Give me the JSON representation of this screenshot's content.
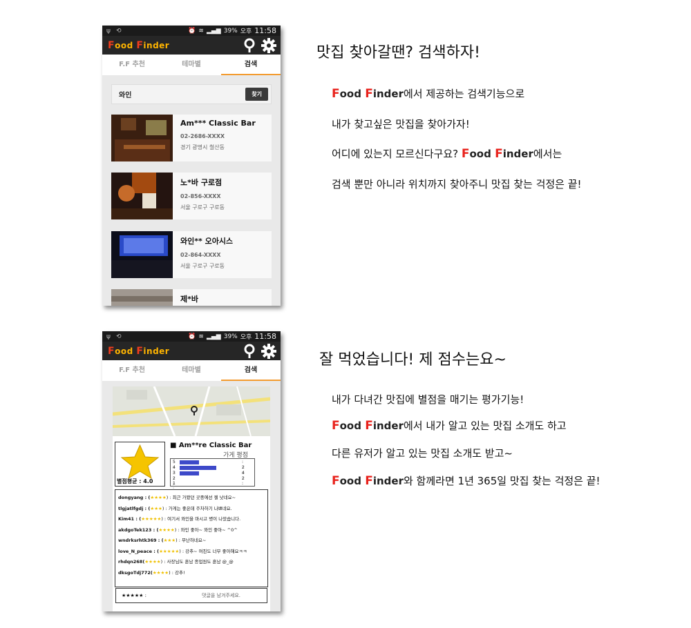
{
  "status_bar": {
    "battery": "39%",
    "time_prefix": "오후",
    "time": "11:58"
  },
  "app": {
    "logo_word1_cap": "F",
    "logo_word1_rest": "ood",
    "logo_word2_cap": "F",
    "logo_word2_rest": "inder"
  },
  "tabs": [
    {
      "label": "F.F 추천"
    },
    {
      "label": "테마별"
    },
    {
      "label": "검색",
      "active": true
    }
  ],
  "search": {
    "value": "와인",
    "button": "찾기"
  },
  "results": [
    {
      "name": "Am*** Classic Bar",
      "phone": "02-2686-XXXX",
      "address": "경기 광명시 철산동"
    },
    {
      "name": "노*바 구로점",
      "phone": "02-856-XXXX",
      "address": "서울 구로구 구로동"
    },
    {
      "name": "와인** 오아시스",
      "phone": "02-864-XXXX",
      "address": "서울 구로구 구로동"
    },
    {
      "name": "제*바",
      "phone": "",
      "address": ""
    }
  ],
  "section1": {
    "heading": "맛집 찾아갈땐? 검색하자!",
    "line1_suffix": "에서 제공하는 검색기능으로",
    "line2": "내가 찾고싶은 맛집을 찾아가자!",
    "line3_prefix": "어디에 있는지 모르신다구요? ",
    "line3_suffix": "에서는",
    "line4": "검색 뿐만 아니라 위치까지 찾아주니 맛집 찾는 걱정은 끝!"
  },
  "section2": {
    "heading": "잘 먹었습니다! 제 점수는요~",
    "line1": "내가 다녀간 맛집에 별점을 매기는 평가기능!",
    "line2_suffix": "에서 내가 알고 있는 맛집 소개도 하고",
    "line3": "다른 유저가 알고 있는 맛집 소개도 받고~",
    "line4_suffix": "와 함께라면 1년 365일 맛집 찾는 걱정은 끝!"
  },
  "store": {
    "title": "■ Am**re Classic Bar",
    "subtitle": "가게 평점",
    "average_label": "별점평균 : 4.0",
    "ratings": [
      {
        "label": "5 :",
        "fraction": 0.32,
        "count": ": 2"
      },
      {
        "label": "4 :",
        "fraction": 0.62,
        "count": ": 4"
      },
      {
        "label": "3 :",
        "fraction": 0.32,
        "count": ": 2"
      },
      {
        "label": "2 :",
        "fraction": 0,
        "count": ":"
      },
      {
        "label": "1 :",
        "fraction": 0,
        "count": ":"
      }
    ]
  },
  "reviews": [
    {
      "user": "dongyang : (",
      "stars": "★★★★",
      "text": ") : 최근 가봤던 곳중에선 젤 낫네요~"
    },
    {
      "user": "tlgjatlfgdj : (",
      "stars": "★★★",
      "text": ") : 가게는 좋은데 주차하기 나쁘네요."
    },
    {
      "user": "Kim41 : (",
      "stars": "★★★★★",
      "text": ") : 여기서 와인을 마시고 병이 나았습니다."
    },
    {
      "user": "akdgoTek123 : (",
      "stars": "★★★★",
      "text": ") : 와인 좋아~ 와인 좋아~ ^0^"
    },
    {
      "user": "wndrksrhtk369 : (",
      "stars": "★★★",
      "text": ") : 무난하네요~"
    },
    {
      "user": "love_N_peace : (",
      "stars": "★★★★★",
      "text": ") : 강추~ 여친도 너무 좋아해요ㅋㅋ"
    },
    {
      "user": "rhdqn268(",
      "stars": "★★★★",
      "text": ") : 사장님도 훈남 종업원도 훈남 @_@"
    },
    {
      "user": "dksgoTdj772(",
      "stars": "★★★★",
      "text": ") : 강추!"
    }
  ],
  "comment": {
    "stars": "★★★★★   :",
    "placeholder": "댓글을 남겨주세요."
  },
  "colors": {
    "logo_orange": "#ffb400",
    "logo_red": "#f23d1d",
    "tab_active": "#f39b2f",
    "bar_blue": "#3d49c9",
    "text_ff_red": "#e8211b"
  }
}
